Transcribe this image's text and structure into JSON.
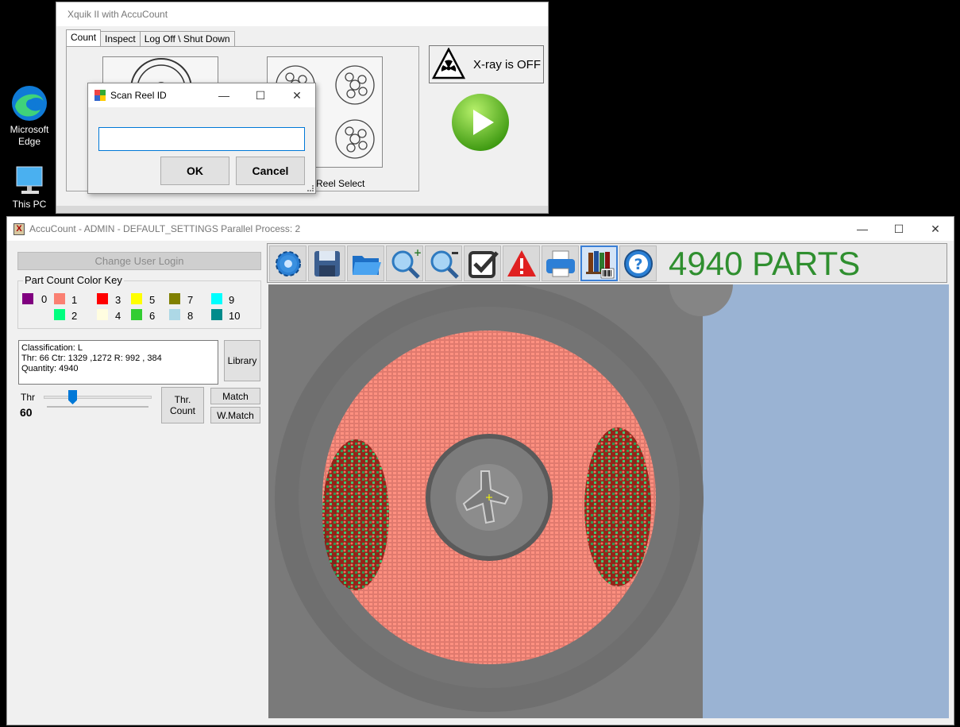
{
  "desktop": {
    "icons": [
      {
        "label_line1": "Microsoft",
        "label_line2": "Edge"
      },
      {
        "label_line1": "This PC",
        "label_line2": ""
      }
    ]
  },
  "xquik": {
    "title": "Xquik II with AccuCount",
    "tabs": [
      "Count",
      "Inspect",
      "Log Off \\ Shut Down"
    ],
    "reel_select_label": "Reel Select",
    "xray_label": "X-ray is OFF"
  },
  "dialog": {
    "title": "Scan Reel ID",
    "input_value": "",
    "ok_label": "OK",
    "cancel_label": "Cancel"
  },
  "accucount": {
    "title": "AccuCount - ADMIN - DEFAULT_SETTINGS Parallel Process: 2",
    "change_user_label": "Change User Login",
    "color_key": {
      "title": "Part Count Color Key",
      "items": [
        {
          "num": "0",
          "color": "#800080"
        },
        {
          "num": "1",
          "color": "#fa8072"
        },
        {
          "num": "2",
          "color": "#00ff7f"
        },
        {
          "num": "3",
          "color": "#ff0000"
        },
        {
          "num": "4",
          "color": "#fffde0"
        },
        {
          "num": "5",
          "color": "#ffff00"
        },
        {
          "num": "6",
          "color": "#32cd32"
        },
        {
          "num": "7",
          "color": "#808000"
        },
        {
          "num": "8",
          "color": "#add8e6"
        },
        {
          "num": "9",
          "color": "#00ffff"
        },
        {
          "num": "10",
          "color": "#008b8b"
        }
      ]
    },
    "info": {
      "classification": "Classification: L",
      "thr_line": "Thr: 66 Ctr: 1329 ,1272 R: 992 , 384",
      "quantity": "Quantity: 4940"
    },
    "library_label": "Library",
    "thr_label": "Thr",
    "thr_value": "60",
    "thr_slider_fraction": 0.25,
    "thr_count_line1": "Thr.",
    "thr_count_line2": "Count",
    "match_label": "Match",
    "wmatch_label": "W.Match",
    "toolbar_icons": [
      "gear-icon",
      "save-icon",
      "folder-open-icon",
      "zoom-in-icon",
      "zoom-out-icon",
      "checkbox-icon",
      "warning-icon",
      "print-icon",
      "library-barcode-icon",
      "help-icon"
    ],
    "parts_count": "4940 PARTS"
  }
}
